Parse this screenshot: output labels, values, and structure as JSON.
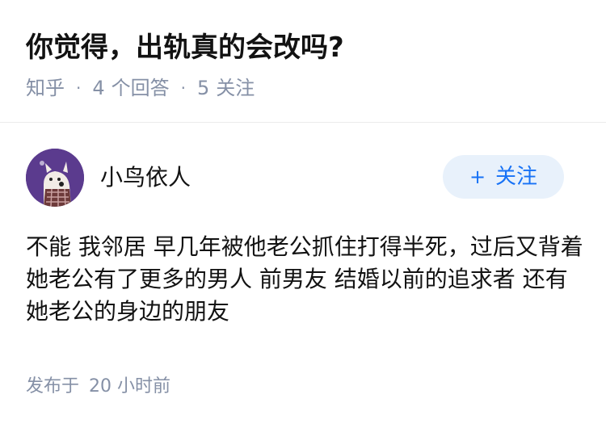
{
  "question": {
    "title": "你觉得，出轨真的会改吗?",
    "source": "知乎",
    "answer_count_num": "4",
    "answer_count_label": "个回答",
    "follow_count_num": "5",
    "follow_count_label": "关注"
  },
  "author": {
    "name": "小鸟依人",
    "avatar_icon": "avatar-image",
    "follow_label": "关注",
    "follow_icon": "plus-icon",
    "accent_color": "#1772f6"
  },
  "answer": {
    "content": "不能 我邻居 早几年被他老公抓住打得半死，过后又背着她老公有了更多的男人 前男友 结婚以前的追求者 还有她老公的身边的朋友"
  },
  "footer": {
    "published_label": "发布于",
    "published_time": "20 小时前"
  }
}
